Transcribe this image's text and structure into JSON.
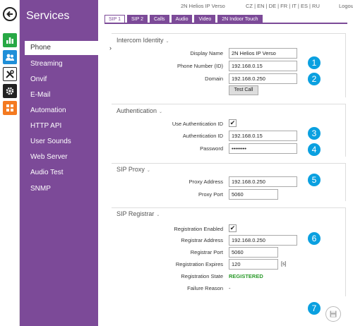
{
  "topbar": {
    "device_name": "2N Helios IP Verso",
    "languages": "CZ | EN | DE | FR | IT | ES | RU",
    "logout": "Logout"
  },
  "sidebar": {
    "title": "Services",
    "items": [
      {
        "label": "Phone",
        "active": true
      },
      {
        "label": "Streaming"
      },
      {
        "label": "Onvif"
      },
      {
        "label": "E-Mail"
      },
      {
        "label": "Automation"
      },
      {
        "label": "HTTP API"
      },
      {
        "label": "User Sounds"
      },
      {
        "label": "Web Server"
      },
      {
        "label": "Audio Test"
      },
      {
        "label": "SNMP"
      }
    ],
    "active_chevron": "›"
  },
  "rail": {
    "icons": [
      "back-arrow-icon",
      "bar-chart-icon",
      "users-icon",
      "tools-icon",
      "gear-icon",
      "grid-icon"
    ],
    "colors": {
      "green": "#27a844",
      "blue": "#1f8fd8",
      "dark": "#222222",
      "orange": "#f47a20"
    }
  },
  "tabs": [
    "SIP 1",
    "SIP 2",
    "Calls",
    "Audio",
    "Video",
    "2N Indoor Touch"
  ],
  "intercom_identity": {
    "title": "Intercom Identity",
    "display_name_label": "Display Name",
    "display_name": "2N Helios IP Verso",
    "phone_number_label": "Phone Number (ID)",
    "phone_number": "192.168.0.15",
    "domain_label": "Domain",
    "domain": "192.168.0.250",
    "test_call": "Test Call"
  },
  "authentication": {
    "title": "Authentication",
    "use_auth_label": "Use Authentication ID",
    "use_auth_checked": "✔",
    "auth_id_label": "Authentication ID",
    "auth_id": "192.168.0.15",
    "password_label": "Password",
    "password": "••••••••"
  },
  "sip_proxy": {
    "title": "SIP Proxy",
    "address_label": "Proxy Address",
    "address": "192.168.0.250",
    "port_label": "Proxy Port",
    "port": "5060"
  },
  "sip_registrar": {
    "title": "SIP Registrar",
    "enabled_label": "Registration Enabled",
    "enabled_checked": "✔",
    "address_label": "Registrar Address",
    "address": "192.168.0.250",
    "port_label": "Registrar Port",
    "port": "5060",
    "expires_label": "Registration Expires",
    "expires": "120",
    "expires_unit": "[s]",
    "state_label": "Registration State",
    "state": "REGISTERED",
    "state_color": "#2a9a2a",
    "failure_label": "Failure Reason",
    "failure": "-"
  },
  "callouts": [
    "1",
    "2",
    "3",
    "4",
    "5",
    "6",
    "7"
  ],
  "caret": "⌄",
  "accent": "#7c4a98",
  "callout_color": "#0aa0e0"
}
